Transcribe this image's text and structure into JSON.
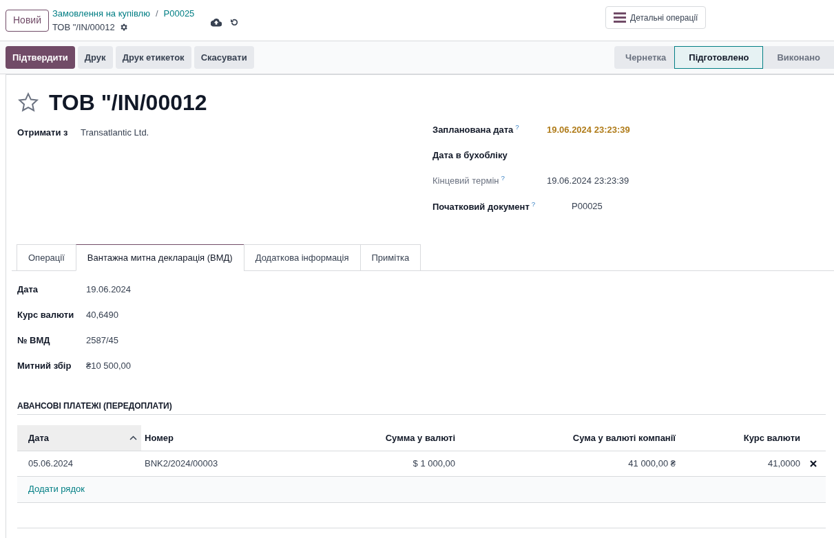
{
  "new_button": "Новий",
  "breadcrumbs": [
    {
      "label": "Замовлення на купівлю"
    },
    {
      "label": "P00025"
    }
  ],
  "breadcrumb_separator": "/",
  "record_name": "ТОВ \"/IN/00012",
  "detail_button": "Детальні операції",
  "actions": [
    {
      "label": "Підтвердити",
      "primary": true
    },
    {
      "label": "Друк",
      "primary": false
    },
    {
      "label": "Друк етикеток",
      "primary": false
    },
    {
      "label": "Скасувати",
      "primary": false
    }
  ],
  "stages": [
    {
      "label": "Чернетка",
      "selected": false
    },
    {
      "label": "Підготовлено",
      "selected": true
    },
    {
      "label": "Виконано",
      "selected": false
    }
  ],
  "title": "ТОВ \"/IN/00012",
  "favorite": false,
  "left_fields": [
    {
      "label": "Отримати з",
      "value": "Transatlantic Ltd."
    }
  ],
  "right_fields": [
    {
      "label": "Запланована дата",
      "help": "?",
      "value": "19.06.2024 23:23:39",
      "muted": false,
      "warning": true
    },
    {
      "label": "Дата в бухобліку",
      "muted": false
    },
    {
      "label": "Кінцевий термін",
      "help": "?",
      "value": "19.06.2024 23:23:39",
      "muted": true,
      "warning": false
    },
    {
      "label": "Початковий документ",
      "help": "?",
      "value": "P00025",
      "muted": false,
      "warning": false
    }
  ],
  "tabs": [
    {
      "label": "Операції",
      "selected": false
    },
    {
      "label": "Вантажна митна декларація (ВМД)",
      "selected": true
    },
    {
      "label": "Додаткова інформація",
      "selected": false
    },
    {
      "label": "Примітка",
      "selected": false
    }
  ],
  "tab_fields": [
    {
      "label": "Дата",
      "value": "19.06.2024"
    },
    {
      "label": "Курс валюти",
      "value": "40,6490"
    },
    {
      "label": "№ ВМД",
      "value": "2587/45"
    },
    {
      "label": "Митний збір",
      "value": "₴10 500,00"
    }
  ],
  "section_title": "АВАНСОВІ ПЛАТЕЖІ (ПЕРЕДОПЛАТИ)",
  "table": {
    "columns": [
      {
        "label": "Дата",
        "kind": "text",
        "sorted": true
      },
      {
        "label": "Номер",
        "kind": "text",
        "sorted": false
      },
      {
        "label": "Сумма у валюті",
        "kind": "number",
        "sorted": false
      },
      {
        "label": "Сума у валюті компанії",
        "kind": "number",
        "sorted": false
      },
      {
        "label": "Курс валюти",
        "kind": "number",
        "sorted": false
      }
    ],
    "rows": [
      [
        "05.06.2024",
        "BNK2/2024/00003",
        "$ 1 000,00",
        "41 000,00 ₴",
        "41,0000"
      ]
    ],
    "add_line": "Додати рядок"
  }
}
